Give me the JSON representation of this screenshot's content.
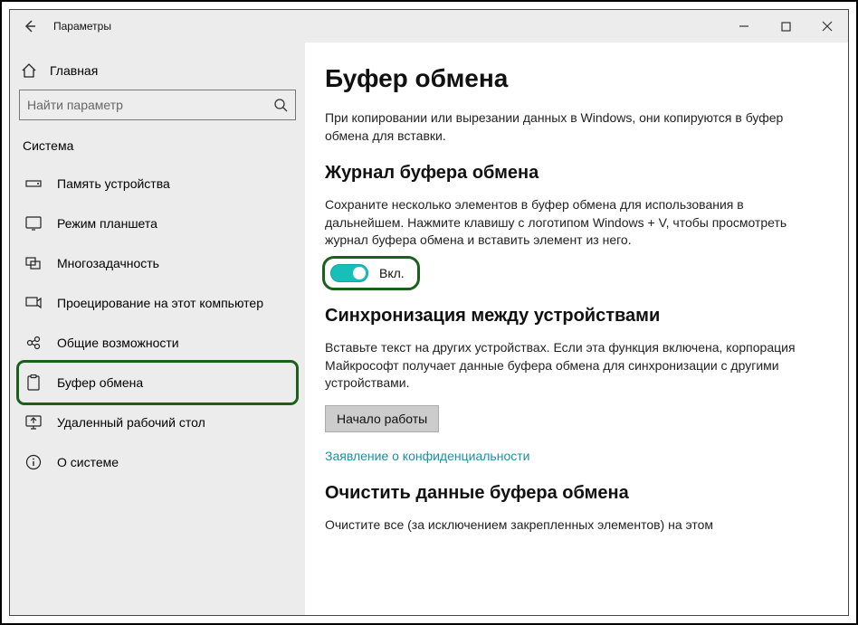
{
  "window": {
    "title": "Параметры"
  },
  "sidebar": {
    "home_label": "Главная",
    "search_placeholder": "Найти параметр",
    "section_label": "Система",
    "items": [
      {
        "icon": "storage-icon",
        "label": "Память устройства"
      },
      {
        "icon": "tablet-icon",
        "label": "Режим планшета"
      },
      {
        "icon": "multitask-icon",
        "label": "Многозадачность"
      },
      {
        "icon": "project-icon",
        "label": "Проецирование на этот компьютер"
      },
      {
        "icon": "shared-icon",
        "label": "Общие возможности"
      },
      {
        "icon": "clipboard-icon",
        "label": "Буфер обмена"
      },
      {
        "icon": "remote-icon",
        "label": "Удаленный рабочий стол"
      },
      {
        "icon": "about-icon",
        "label": "О системе"
      }
    ]
  },
  "content": {
    "heading": "Буфер обмена",
    "intro": "При копировании или вырезании данных в Windows, они копируются в буфер обмена для вставки.",
    "history": {
      "heading": "Журнал буфера обмена",
      "text": "Сохраните несколько элементов в буфер обмена для использования в дальнейшем. Нажмите клавишу с логотипом Windows + V, чтобы просмотреть журнал буфера обмена и вставить элемент из него.",
      "toggle_label": "Вкл."
    },
    "sync": {
      "heading": "Синхронизация между устройствами",
      "text": "Вставьте текст на других устройствах. Если эта функция включена, корпорация Майкрософт получает данные буфера обмена для синхронизации с другими устройствами.",
      "button": "Начало работы",
      "privacy_link": "Заявление о конфиденциальности"
    },
    "clear": {
      "heading": "Очистить данные буфера обмена",
      "text": "Очистите все (за исключением закрепленных элементов) на этом"
    }
  }
}
